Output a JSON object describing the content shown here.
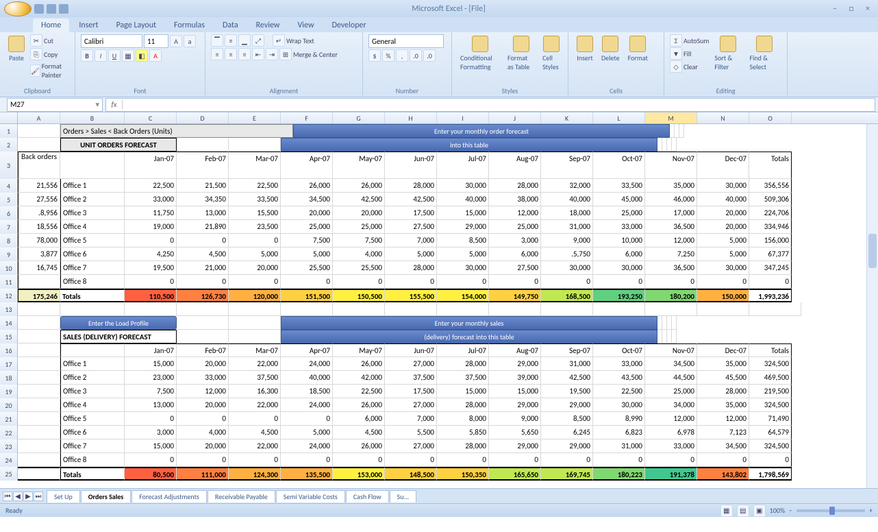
{
  "title": "Microsoft Excel - [File]",
  "ribbonTabs": [
    "Home",
    "Insert",
    "Page Layout",
    "Formulas",
    "Data",
    "Review",
    "View",
    "Developer"
  ],
  "activeTab": "Home",
  "font": {
    "name": "Calibri",
    "size": "11"
  },
  "numberFormat": "General",
  "groups": {
    "clipboard": "Clipboard",
    "font": "Font",
    "alignment": "Alignment",
    "number": "Number",
    "styles": "Styles",
    "cells": "Cells",
    "editing": "Editing"
  },
  "clipboardItems": {
    "paste": "Paste",
    "cut": "Cut",
    "copy": "Copy",
    "fp": "Format Painter"
  },
  "alignItems": {
    "wrap": "Wrap Text",
    "merge": "Merge & Center"
  },
  "styleBtns": {
    "cond": "Conditional Formatting",
    "fmt": "Format as Table",
    "cell": "Cell Styles"
  },
  "cellBtns": {
    "ins": "Insert",
    "del": "Delete",
    "fmt": "Format"
  },
  "editBtns": {
    "sum": "AutoSum",
    "fill": "Fill",
    "clear": "Clear",
    "sort": "Sort & Filter",
    "find": "Find & Select"
  },
  "nameBox": "M27",
  "cols": [
    "A",
    "B",
    "C",
    "D",
    "E",
    "F",
    "G",
    "H",
    "I",
    "J",
    "K",
    "L",
    "M",
    "N",
    "O"
  ],
  "activeCol": "M",
  "rowNums": [
    "1",
    "2",
    "3",
    "4",
    "5",
    "6",
    "7",
    "8",
    "9",
    "10",
    "11",
    "12",
    "13",
    "14",
    "15",
    "16",
    "17",
    "18",
    "19",
    "20",
    "21",
    "22",
    "23",
    "24",
    "25"
  ],
  "header1": "Orders > Sales < Back Orders (Units)",
  "header2": "UNIT ORDERS FORECAST",
  "banner1a": "Enter your monthly order forecast",
  "banner1b": "into this table",
  "backOrdersLabel": "Back orders",
  "months": [
    "Jan-07",
    "Feb-07",
    "Mar-07",
    "Apr-07",
    "May-07",
    "Jun-07",
    "Jul-07",
    "Aug-07",
    "Sep-07",
    "Oct-07",
    "Nov-07",
    "Dec-07"
  ],
  "totalsLabel": "Totals",
  "ordersBack": [
    "21,556",
    "27,556",
    ".8,956",
    "18,556",
    "78,000",
    "3,877",
    "16,745",
    ""
  ],
  "offices": [
    "Office 1",
    "Office 2",
    "Office 3",
    "Office 4",
    "Office 5",
    "Office 6",
    "Office 7",
    "Office 8"
  ],
  "ordersData": [
    [
      "22,500",
      "21,500",
      "22,500",
      "26,000",
      "26,000",
      "28,000",
      "30,000",
      "28,000",
      "32,000",
      "33,500",
      "35,000",
      "30,000",
      "356,556"
    ],
    [
      "33,000",
      "34,350",
      "33,500",
      "34,500",
      "42,500",
      "42,500",
      "40,000",
      "38,000",
      "40,000",
      "45,000",
      "46,000",
      "40,000",
      "509,306"
    ],
    [
      "11,750",
      "13,000",
      "15,500",
      "20,000",
      "20,000",
      "17,500",
      "15,000",
      "12,000",
      "18,000",
      "25,000",
      "17,000",
      "20,000",
      "224,706"
    ],
    [
      "19,000",
      "21,890",
      "23,500",
      "25,000",
      "25,000",
      "27,500",
      "29,000",
      "25,000",
      "31,000",
      "33,000",
      "36,500",
      "20,000",
      "334,946"
    ],
    [
      "0",
      "0",
      "0",
      "7,500",
      "7,500",
      "7,000",
      "8,500",
      "3,000",
      "9,000",
      "10,000",
      "12,000",
      "5,000",
      "156,000"
    ],
    [
      "4,250",
      "4,500",
      "5,000",
      "5,000",
      "4,000",
      "5,000",
      "5,000",
      "6,000",
      ".5,750",
      "6,000",
      "7,250",
      "5,000",
      "67,377"
    ],
    [
      "19,500",
      "21,000",
      "20,000",
      "25,500",
      "25,500",
      "28,000",
      "30,000",
      "27,500",
      "30,000",
      "30,000",
      "36,500",
      "30,000",
      "347,245"
    ],
    [
      "0",
      "0",
      "0",
      "0",
      "0",
      "0",
      "0",
      "0",
      "0",
      "0",
      "0",
      "0",
      "0"
    ]
  ],
  "ordersTotals": [
    "175,246",
    "Totals",
    "110,500",
    "126,730",
    "120,000",
    "151,500",
    "150,500",
    "155,500",
    "154,000",
    "149,750",
    "168,500",
    "193,250",
    "180,200",
    "150,000",
    "1,993,236"
  ],
  "banner2btn": "Enter the Load Profile",
  "header3": "SALES (DELIVERY) FORECAST",
  "banner2a": "Enter your monthly sales",
  "banner2b": "(delivery) forecast into this table",
  "salesData": [
    [
      "15,000",
      "20,000",
      "22,000",
      "24,000",
      "26,000",
      "27,000",
      "28,000",
      "29,000",
      "31,000",
      "33,000",
      "34,500",
      "35,000",
      "324,500"
    ],
    [
      "23,000",
      "33,000",
      "37,500",
      "40,000",
      "42,000",
      "37,500",
      "37,500",
      "39,000",
      "42,500",
      "43,500",
      "44,500",
      "45,500",
      "469,500"
    ],
    [
      "7,500",
      "12,000",
      "16,300",
      "18,500",
      "22,500",
      "17,500",
      "15,000",
      "15,000",
      "19,500",
      "22,500",
      "25,000",
      "28,000",
      "219,500"
    ],
    [
      "13,000",
      "20,000",
      "22,000",
      "24,000",
      "26,000",
      "27,000",
      "28,000",
      "29,000",
      "29,000",
      "30,000",
      "34,000",
      "35,000",
      "324,500"
    ],
    [
      "0",
      "0",
      "0",
      "0",
      "6,000",
      "7,000",
      "8,000",
      "9,000",
      "8,500",
      "8,990",
      "12,000",
      "12,000",
      "71,490"
    ],
    [
      "3,000",
      "4,000",
      "4,500",
      "5,000",
      "4,500",
      "5,500",
      "5,850",
      "5,650",
      "6,245",
      "6,823",
      "6,978",
      "7,123",
      "64,579"
    ],
    [
      "15,000",
      "20,000",
      "22,000",
      "24,000",
      "26,000",
      "27,000",
      "28,000",
      "29,000",
      "29,000",
      "31,000",
      "33,000",
      "34,500",
      "324,500"
    ],
    [
      "0",
      "0",
      "0",
      "0",
      "0",
      "0",
      "0",
      "0",
      "0",
      "0",
      "0",
      "0",
      "0"
    ]
  ],
  "salesTotals": [
    "Totals",
    "80,500",
    "111,000",
    "124,300",
    "135,500",
    "153,000",
    "148,500",
    "150,350",
    "165,650",
    "169,745",
    "180,223",
    "191,378",
    "143,802",
    "1,798,569"
  ],
  "sheetTabs": [
    "Set Up",
    "Orders Sales",
    "Forecast Adjustments",
    "Receivable Payable",
    "Semi Variable Costs",
    "Cash Flow",
    "Su..."
  ],
  "activeSheet": "Orders Sales",
  "status": "Ready",
  "zoom": "100%"
}
